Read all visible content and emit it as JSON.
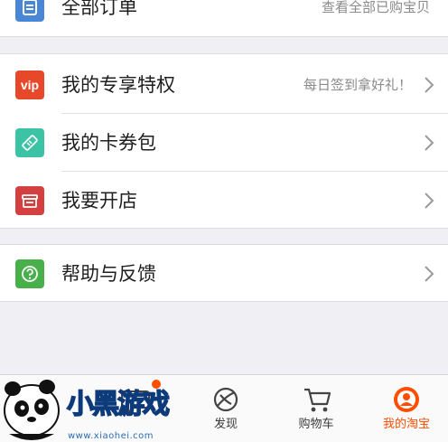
{
  "colors": {
    "vip": "#e8482a",
    "coupon": "#3cc3a6",
    "store": "#d44040",
    "help": "#47b04b",
    "orders": "#4a86d6",
    "active_tab": "#ff4e00"
  },
  "orders_row": {
    "label": "全部订单",
    "hint": "查看全部已购宝贝",
    "icon": "list-icon"
  },
  "menu": {
    "privilege": {
      "icon_text": "vip",
      "label": "我的专享特权",
      "hint": "每日签到拿好礼！"
    },
    "coupons": {
      "label": "我的卡券包",
      "icon": "ticket-icon"
    },
    "store": {
      "label": "我要开店",
      "icon": "storefront-icon"
    },
    "help": {
      "label": "帮助与反馈",
      "icon": "question-icon"
    }
  },
  "tabbar": {
    "tabs": [
      {
        "label": "",
        "icon": "message-icon"
      },
      {
        "label": "发现",
        "icon": "planet-icon"
      },
      {
        "label": "购物车",
        "icon": "cart-icon"
      },
      {
        "label": "我的淘宝",
        "icon": "avatar-icon",
        "active": true
      }
    ]
  },
  "watermark": {
    "brand": "小黑游戏",
    "url": "www.xiaohei.com"
  }
}
